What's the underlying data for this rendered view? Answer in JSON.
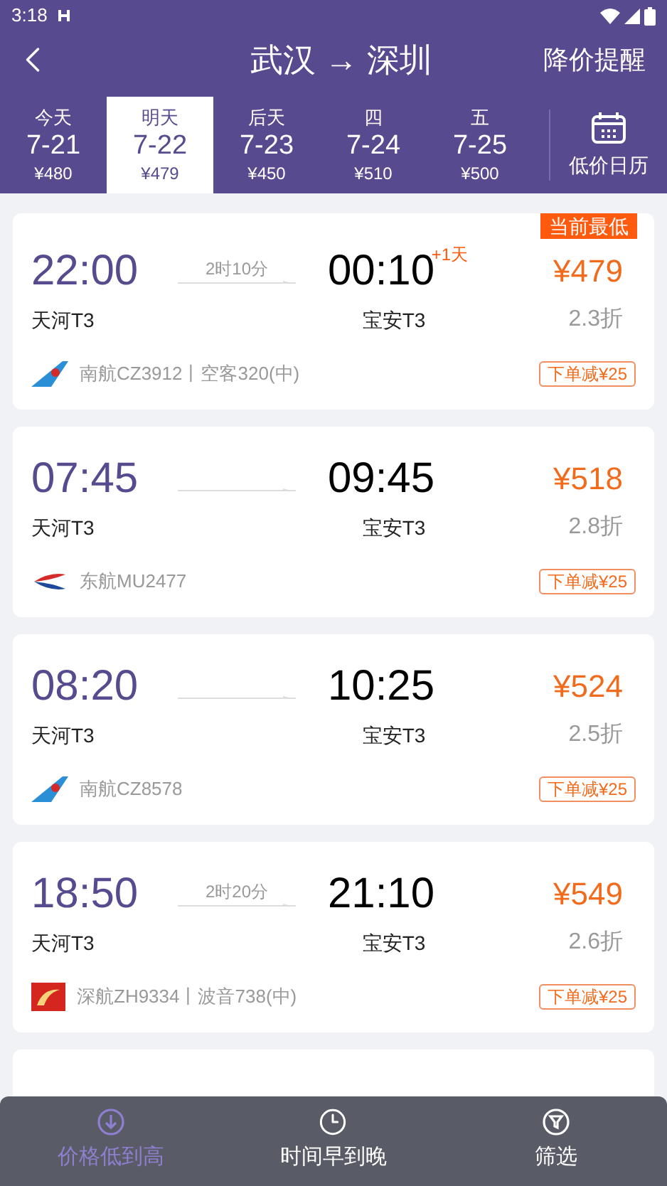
{
  "status_bar": {
    "time": "3:18"
  },
  "header": {
    "title": "武汉 → 深圳",
    "action": "降价提醒"
  },
  "date_tabs": [
    {
      "day": "今天",
      "date": "7-21",
      "price": "¥480",
      "selected": false
    },
    {
      "day": "明天",
      "date": "7-22",
      "price": "¥479",
      "selected": true
    },
    {
      "day": "后天",
      "date": "7-23",
      "price": "¥450",
      "selected": false
    },
    {
      "day": "四",
      "date": "7-24",
      "price": "¥510",
      "selected": false
    },
    {
      "day": "五",
      "date": "7-25",
      "price": "¥500",
      "selected": false
    }
  ],
  "calendar_button": {
    "label": "低价日历"
  },
  "flights": [
    {
      "badge": "当前最低",
      "depart": "22:00",
      "arrive": "00:10",
      "next_day": "+1天",
      "duration": "2时10分",
      "from": "天河T3",
      "to": "宝安T3",
      "price": "¥479",
      "discount": "2.3折",
      "kind": "cz",
      "info": "南航CZ3912丨空客320(中)",
      "promo": "下单减¥25"
    },
    {
      "depart": "07:45",
      "arrive": "09:45",
      "from": "天河T3",
      "to": "宝安T3",
      "price": "¥518",
      "discount": "2.8折",
      "kind": "mu",
      "info": "东航MU2477",
      "promo": "下单减¥25"
    },
    {
      "depart": "08:20",
      "arrive": "10:25",
      "from": "天河T3",
      "to": "宝安T3",
      "price": "¥524",
      "discount": "2.5折",
      "kind": "cz",
      "info": "南航CZ8578",
      "promo": "下单减¥25"
    },
    {
      "depart": "18:50",
      "arrive": "21:10",
      "duration": "2时20分",
      "from": "天河T3",
      "to": "宝安T3",
      "price": "¥549",
      "discount": "2.6折",
      "kind": "zh",
      "info": "深航ZH9334丨波音738(中)",
      "promo": "下单减¥25"
    }
  ],
  "sort_bar": [
    {
      "kind": "price",
      "label": "价格低到高",
      "selected": true
    },
    {
      "kind": "time",
      "label": "时间早到晚",
      "selected": false
    },
    {
      "kind": "filter",
      "label": "筛选",
      "selected": false
    }
  ]
}
